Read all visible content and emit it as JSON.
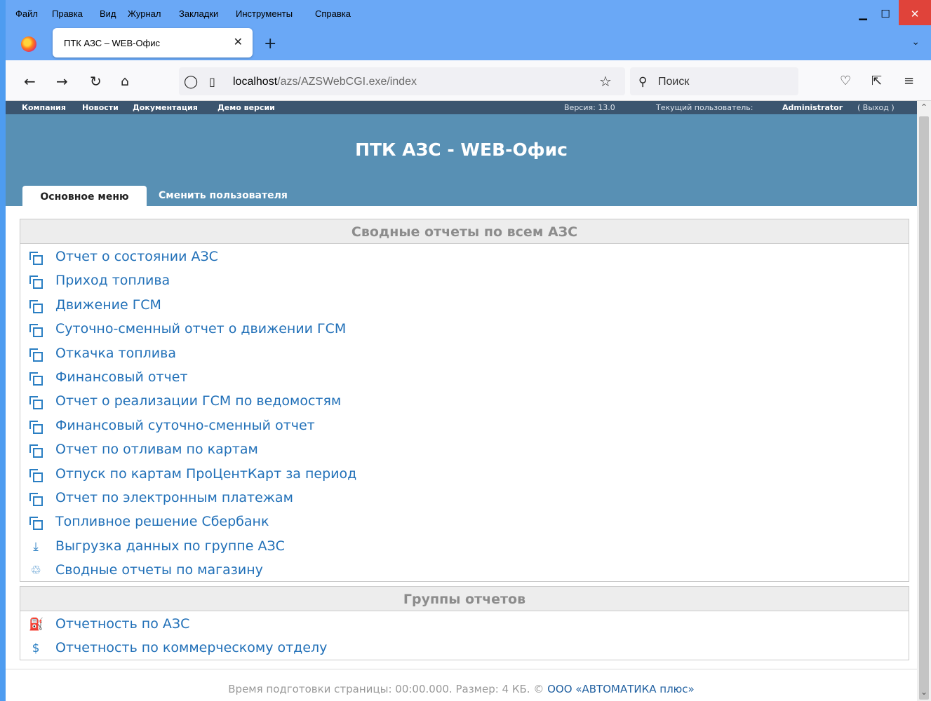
{
  "menubar": {
    "items": [
      "Файл",
      "Правка",
      "Вид",
      "Журнал",
      "Закладки",
      "Инструменты",
      "Справка"
    ]
  },
  "browser": {
    "tab_title": "ПТК АЗС – WEB-Офис",
    "url_host": "localhost",
    "url_path": "/azs/AZSWebCGI.exe/index",
    "search_placeholder": "Поиск"
  },
  "topbar": {
    "links": [
      "Компания",
      "Новости",
      "Документация",
      "Демо версии"
    ],
    "version": "Версия: 13.0",
    "user_prefix": "Текущий пользователь:",
    "user_name": "Administrator",
    "logout_label": "( Выход )"
  },
  "header": {
    "title": "ПТК АЗС - WEB-Офис"
  },
  "tabs": {
    "active": "Основное меню",
    "other": "Сменить пользователя"
  },
  "summary": {
    "title": "Сводные отчеты по всем АЗС",
    "items": [
      {
        "label": "Отчет о состоянии АЗС",
        "icon": "copy-icon"
      },
      {
        "label": "Приход топлива",
        "icon": "copy-icon"
      },
      {
        "label": "Движение ГСМ",
        "icon": "copy-icon"
      },
      {
        "label": "Суточно-сменный отчет о движении ГСМ",
        "icon": "copy-icon"
      },
      {
        "label": "Откачка топлива",
        "icon": "copy-icon"
      },
      {
        "label": "Финансовый отчет",
        "icon": "copy-icon"
      },
      {
        "label": "Отчет о реализации ГСМ по ведомостям",
        "icon": "copy-icon"
      },
      {
        "label": "Финансовый суточно-сменный отчет",
        "icon": "copy-icon"
      },
      {
        "label": "Отчет по отливам по картам",
        "icon": "copy-icon"
      },
      {
        "label": "Отпуск по картам ПроЦентКарт за период",
        "icon": "copy-icon"
      },
      {
        "label": "Отчет по электронным платежам",
        "icon": "copy-icon"
      },
      {
        "label": "Топливное решение Сбербанк",
        "icon": "copy-icon"
      },
      {
        "label": "Выгрузка данных по группе АЗС",
        "icon": "download-icon"
      },
      {
        "label": "Сводные отчеты по магазину",
        "icon": "recycle-icon"
      }
    ]
  },
  "groups": {
    "title": "Группы отчетов",
    "items": [
      {
        "label": "Отчетность по АЗС",
        "icon": "fuel-pump-icon"
      },
      {
        "label": "Отчетность по коммерческому отделу",
        "icon": "dollar-circle-icon"
      }
    ]
  },
  "footer": {
    "text": "Время подготовки страницы: 00:00.000. Размер: 4 КБ. ©",
    "company": "ООО «АВТОМАТИКА плюс»"
  },
  "colors": {
    "link": "#2170b8",
    "header_bg": "#5890b4",
    "topbar_bg": "#3b556f",
    "chrome": "#6aa8f6"
  }
}
